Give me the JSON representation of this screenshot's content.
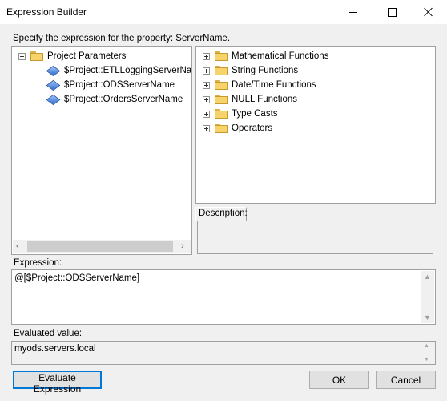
{
  "window": {
    "title": "Expression Builder"
  },
  "prompt": "Specify the expression for the property: ServerName.",
  "variables_tree": {
    "root_label": "Project Parameters",
    "items": [
      "$Project::ETLLoggingServerName",
      "$Project::ODSServerName",
      "$Project::OrdersServerName"
    ]
  },
  "functions_tree": {
    "items": [
      "Mathematical Functions",
      "String Functions",
      "Date/Time Functions",
      "NULL Functions",
      "Type Casts",
      "Operators"
    ]
  },
  "description": {
    "label": "Description:"
  },
  "expression": {
    "label": "Expression:",
    "value": "@[$Project::ODSServerName]"
  },
  "evaluated": {
    "label": "Evaluated value:",
    "value": "myods.servers.local"
  },
  "buttons": {
    "evaluate": "Evaluate Expression",
    "ok": "OK",
    "cancel": "Cancel"
  }
}
